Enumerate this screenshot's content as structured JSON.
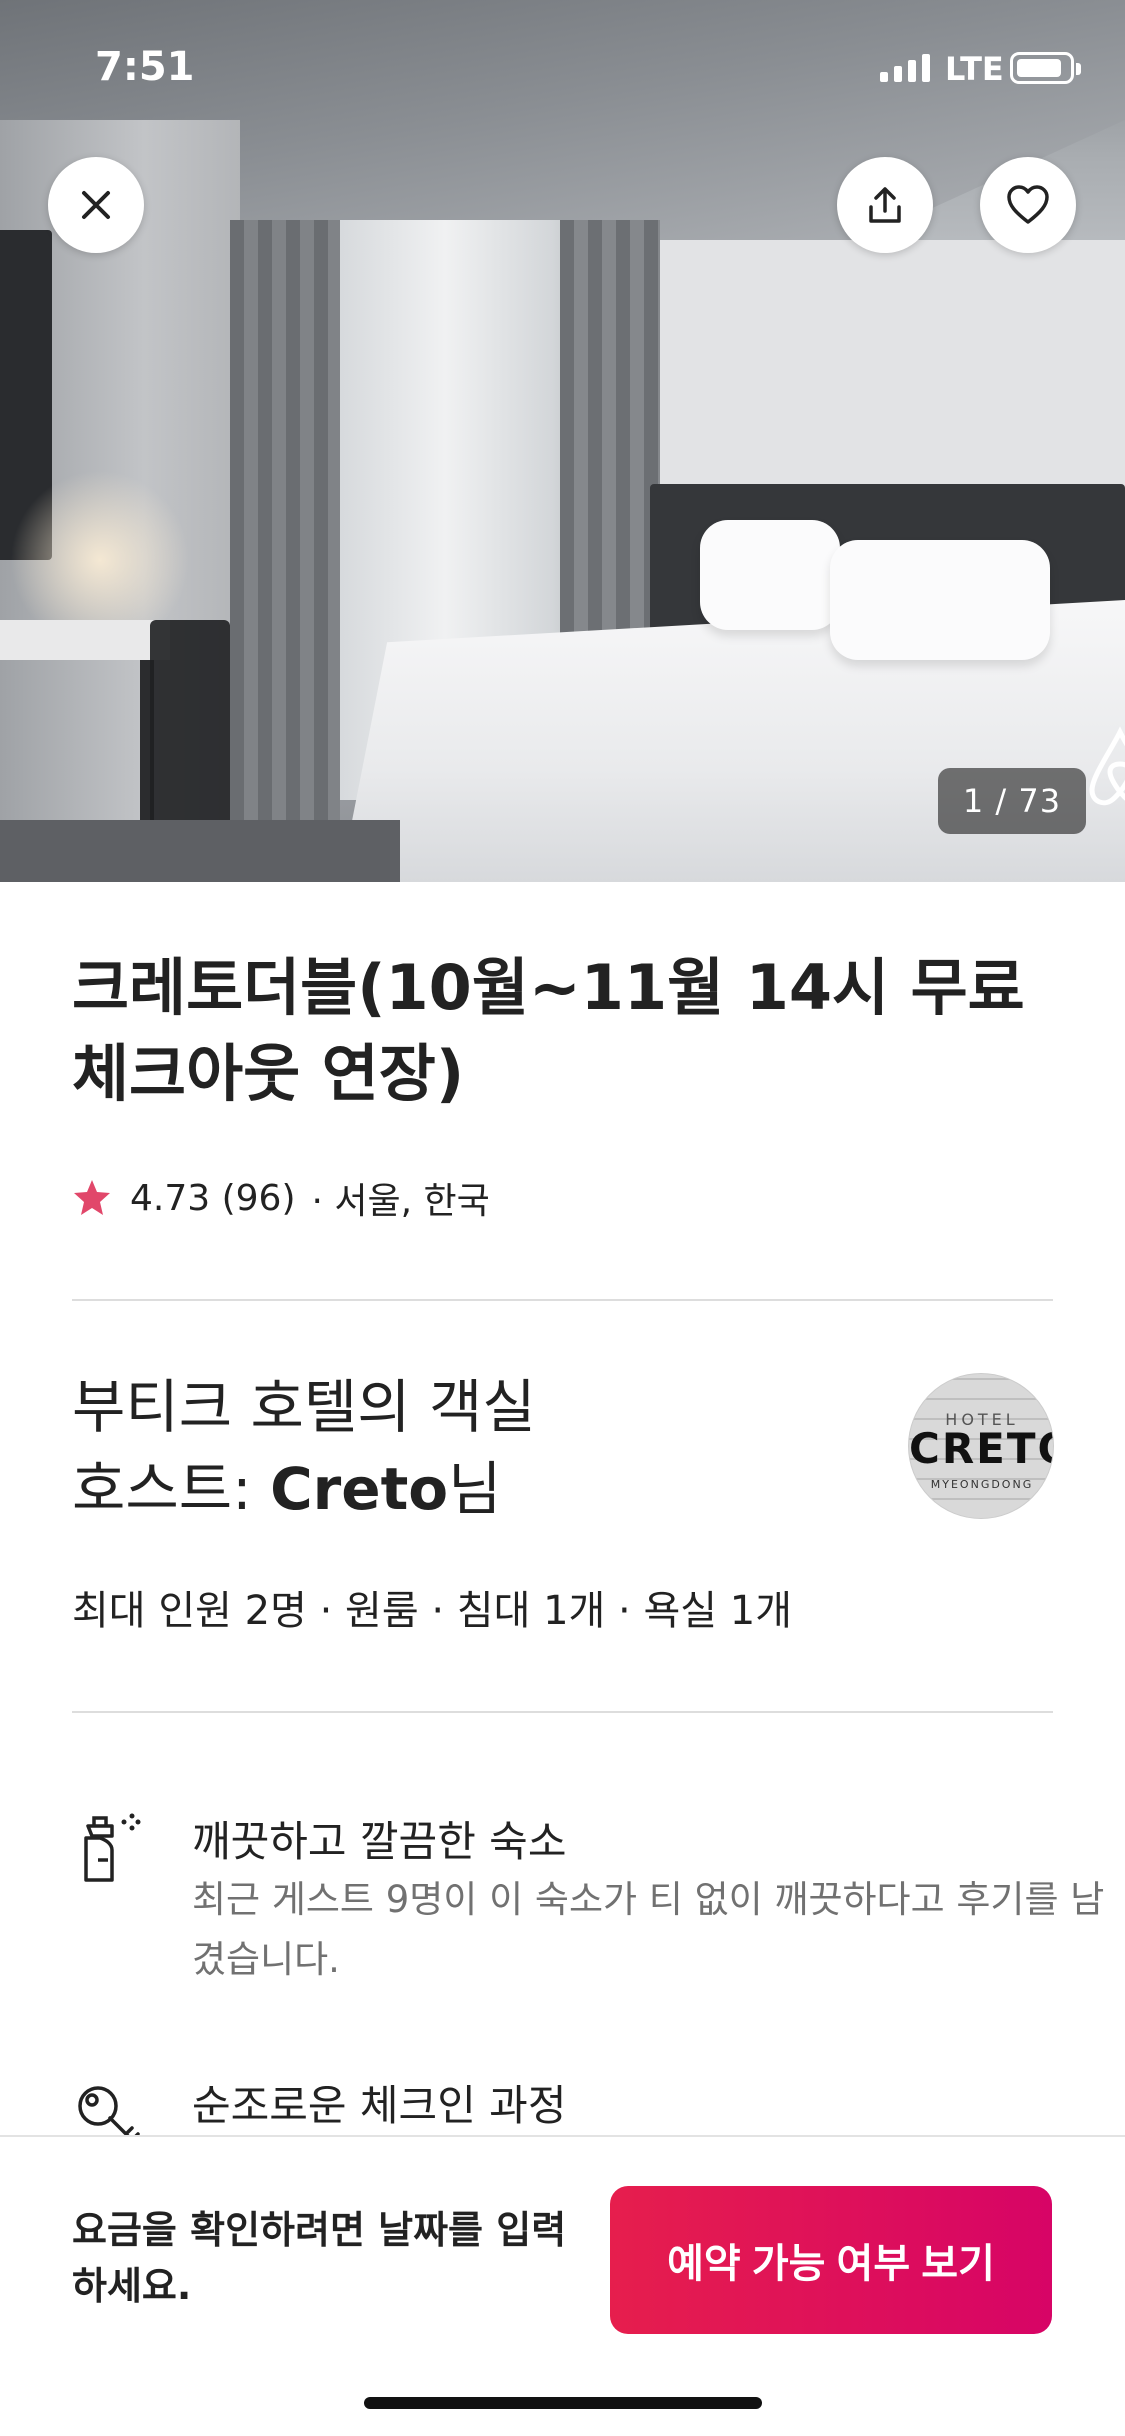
{
  "status_bar": {
    "time": "7:51",
    "network": "LTE"
  },
  "gallery": {
    "counter": "1 / 73",
    "close_icon": "close-icon",
    "share_icon": "share-icon",
    "favorite_icon": "heart-icon"
  },
  "listing": {
    "title": "크레토더블(10월~11월  14시 무료 체크아웃 연장)",
    "rating": "4.73 (96)",
    "location": "· 서울, 한국",
    "star_color": "#e1476a"
  },
  "host": {
    "room_type": "부티크 호텔의 객실",
    "host_prefix": "호스트: ",
    "host_name": "Creto",
    "host_suffix": "님",
    "avatar_text": "CRETO",
    "avatar_top": "HOTEL",
    "avatar_bottom": "MYEONGDONG"
  },
  "room_info": "최대 인원 2명 · 원룸 · 침대 1개 · 욕실 1개",
  "features": [
    {
      "icon": "spray-bottle-icon",
      "title": "깨끗하고 깔끔한 숙소",
      "description": "최근 게스트 9명이 이 숙소가 티 없이 깨끗하다고 후기를 남겼습니다."
    },
    {
      "icon": "key-icon",
      "title": "순조로운 체크인 과정",
      "description": ""
    }
  ],
  "bottom_bar": {
    "price_prompt": "요금을 확인하려면 날짜를 입력하세요.",
    "cta_label": "예약 가능 여부 보기",
    "cta_color": "#e61e4d"
  }
}
